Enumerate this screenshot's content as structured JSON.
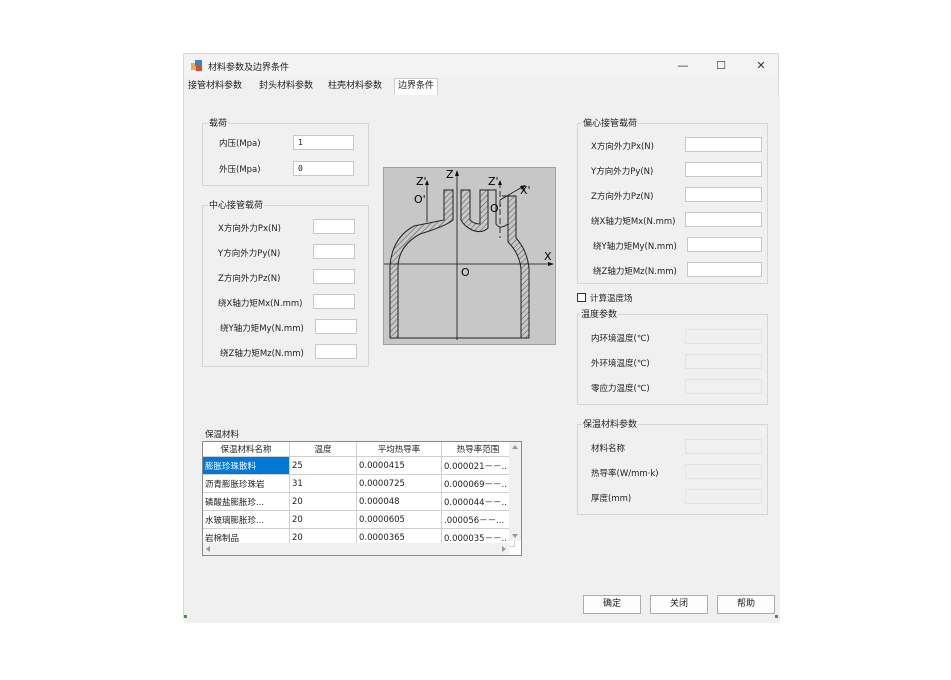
{
  "window": {
    "title": "材料参数及边界条件",
    "minimize": "—",
    "maximize": "☐",
    "close": "✕"
  },
  "tabs": [
    {
      "label": "接管材料参数"
    },
    {
      "label": "封头材料参数"
    },
    {
      "label": "柱壳材料参数"
    },
    {
      "label": "边界条件"
    }
  ],
  "load": {
    "title": "载荷",
    "inner_label": "内压(Mpa)",
    "inner_value": "1",
    "outer_label": "外压(Mpa)",
    "outer_value": "0"
  },
  "center": {
    "title": "中心接管载荷",
    "items": [
      {
        "label": "X方向外力Px(N)",
        "value": ""
      },
      {
        "label": "Y方向外力Py(N)",
        "value": ""
      },
      {
        "label": "Z方向外力Pz(N)",
        "value": ""
      },
      {
        "label": "绕X轴力矩Mx(N.mm)",
        "value": ""
      },
      {
        "label": "绕Y轴力矩My(N.mm)",
        "value": ""
      },
      {
        "label": "绕Z轴力矩Mz(N.mm)",
        "value": ""
      }
    ]
  },
  "eccentric": {
    "title": "偏心接管载荷",
    "items": [
      {
        "label": "X方向外力Px(N)",
        "value": ""
      },
      {
        "label": "Y方向外力Py(N)",
        "value": ""
      },
      {
        "label": "Z方向外力Pz(N)",
        "value": ""
      },
      {
        "label": "绕X轴力矩Mx(N.mm)",
        "value": ""
      },
      {
        "label": "绕Y轴力矩My(N.mm)",
        "value": ""
      },
      {
        "label": "绕Z轴力矩Mz(N.mm)",
        "value": ""
      }
    ]
  },
  "diagram": {
    "z1": "Z'",
    "z": "Z",
    "z2": "Z'",
    "xp": "X'",
    "o1": "O'",
    "o2": "O'",
    "x": "X",
    "o": "O"
  },
  "temp_field": {
    "label": "计算温度场"
  },
  "temp": {
    "title": "温度参数",
    "items": [
      {
        "label": "内环境温度(℃)",
        "value": ""
      },
      {
        "label": "外环境温度(℃)",
        "value": ""
      },
      {
        "label": "零应力温度(℃)",
        "value": ""
      }
    ]
  },
  "insulation": {
    "title": "保温材料",
    "columns": [
      "保温材料名称",
      "温度",
      "平均热导率",
      "热导率范围"
    ],
    "rows": [
      [
        "膨胀珍珠散料",
        "25",
        "0.0000415",
        "0.000021－－.."
      ],
      [
        "沥青膨胀珍珠岩",
        "31",
        "0.0000725",
        "0.000069－－.."
      ],
      [
        "磷酸盐膨胀珍...",
        "20",
        "0.000048",
        "0.000044－－.."
      ],
      [
        "水玻璃膨胀珍...",
        "20",
        "0.0000605",
        ".000056－－..."
      ],
      [
        "岩棉制品",
        "20",
        "0.0000365",
        "0.000035－－.."
      ]
    ]
  },
  "ins_params": {
    "title": "保温材料参数",
    "items": [
      {
        "label": "材料名称",
        "value": ""
      },
      {
        "label": "热导率(W/mm·k)",
        "value": ""
      },
      {
        "label": "厚度(mm)",
        "value": ""
      }
    ]
  },
  "buttons": {
    "ok": "确定",
    "close": "关闭",
    "help": "帮助"
  }
}
